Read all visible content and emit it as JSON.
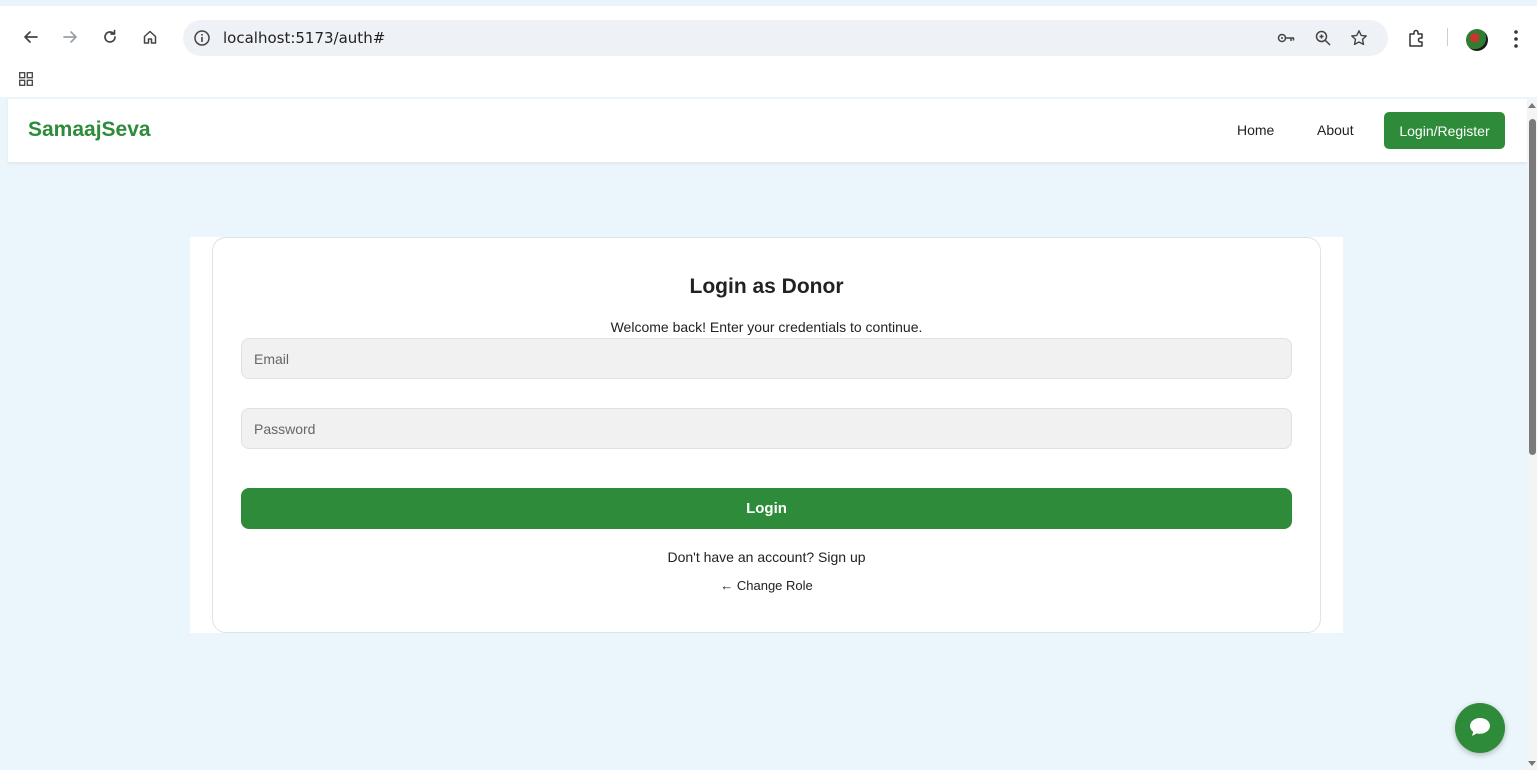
{
  "browser": {
    "url": "localhost:5173/auth#",
    "icons": {
      "back": "back-arrow-icon",
      "forward": "forward-arrow-icon",
      "reload": "reload-icon",
      "home": "home-icon",
      "site_info": "info-icon",
      "password": "key-icon",
      "zoom": "zoom-icon",
      "bookmark": "star-icon",
      "extensions": "puzzle-icon",
      "profile": "avatar",
      "menu": "kebab-menu-icon",
      "apps": "apps-grid-icon"
    }
  },
  "navbar": {
    "brand": "SamaajSeva",
    "links": [
      "Home",
      "About"
    ],
    "cta": "Login/Register"
  },
  "login": {
    "title": "Login as Donor",
    "subtitle": "Welcome back! Enter your credentials to continue.",
    "email_placeholder": "Email",
    "email_value": "",
    "password_placeholder": "Password",
    "password_value": "",
    "submit_label": "Login",
    "signup_prompt": "Don't have an account?",
    "signup_link": "Sign up",
    "change_role": "← Change Role"
  },
  "chat": {
    "icon": "chat-bubble-icon"
  },
  "colors": {
    "brand_green": "#2e8b3a",
    "page_background": "#eaf6fb",
    "field_background": "#f1f1f1"
  }
}
